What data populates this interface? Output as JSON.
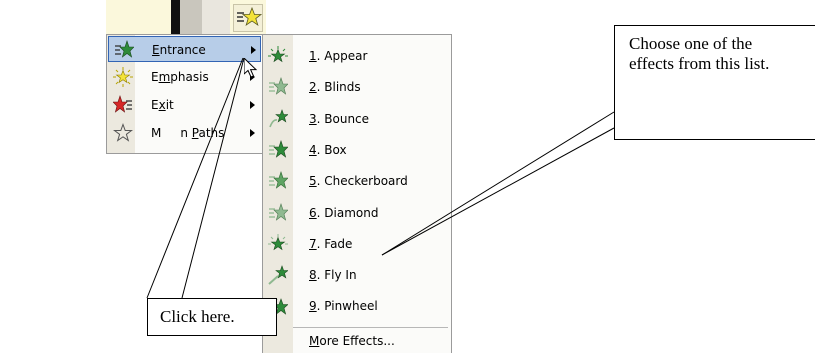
{
  "menu1": {
    "items": [
      {
        "id": "entrance",
        "pre": "",
        "key": "E",
        "post": "ntrance",
        "icon": "entrance-green-star-icon",
        "highlighted": true
      },
      {
        "id": "emphasis",
        "pre": "E",
        "key": "m",
        "post": "phasis",
        "icon": "emphasis-yellow-star-icon",
        "highlighted": false
      },
      {
        "id": "exit",
        "pre": "E",
        "key": "x",
        "post": "it",
        "icon": "exit-red-star-icon",
        "highlighted": false
      },
      {
        "id": "motion-paths",
        "pre": "M",
        "key": "",
        "post": "",
        "pre2": " ",
        "key2": "P",
        "post2": "aths",
        "icon": "motion-paths-star-icon",
        "highlighted": false
      }
    ],
    "motion_label_visible_start": "M",
    "motion_label_visible_end": "n "
  },
  "menu2": {
    "items": [
      {
        "num": "1",
        "rest": ". Appear",
        "icon": "appear-effect-icon"
      },
      {
        "num": "2",
        "rest": ". Blinds",
        "icon": "blinds-effect-icon"
      },
      {
        "num": "3",
        "rest": ". Bounce",
        "icon": "bounce-effect-icon"
      },
      {
        "num": "4",
        "rest": ". Box",
        "icon": "box-effect-icon"
      },
      {
        "num": "5",
        "rest": ". Checkerboard",
        "icon": "checkerboard-effect-icon"
      },
      {
        "num": "6",
        "rest": ". Diamond",
        "icon": "diamond-effect-icon"
      },
      {
        "num": "7",
        "rest": ". Fade",
        "icon": "fade-effect-icon"
      },
      {
        "num": "8",
        "rest": ". Fly In",
        "icon": "fly-in-effect-icon"
      },
      {
        "num": "9",
        "rest": ". Pinwheel",
        "icon": "pinwheel-effect-icon"
      }
    ],
    "more_key": "M",
    "more_rest": "ore Effects..."
  },
  "callouts": {
    "click_here": "Click here.",
    "choose": "Choose one of the effects from this list."
  },
  "colors": {
    "highlight_bg": "#b7cde8",
    "highlight_border": "#3264b4",
    "menu_strip": "#ece9df",
    "star_green": "#2e8b3a",
    "star_yellow": "#f3e33a",
    "star_red": "#d62828"
  }
}
